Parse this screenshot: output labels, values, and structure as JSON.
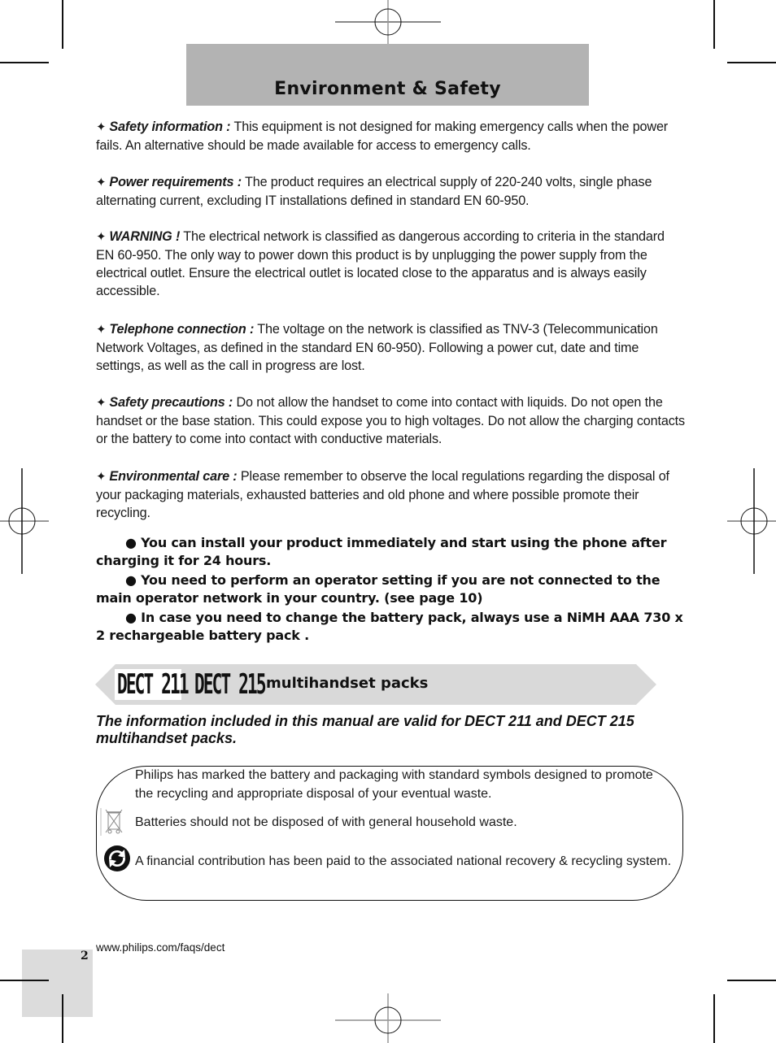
{
  "header": {
    "title": "Environment & Safety"
  },
  "sections": [
    {
      "lead": "Safety information :",
      "text": " This equipment is not designed for making emergency calls when the power fails. An alternative should be made available for access to emergency calls."
    },
    {
      "lead": "Power requirements :",
      "text": " The product requires an electrical supply of 220-240 volts, single phase alternating current, excluding IT installations defined in standard EN 60-950."
    },
    {
      "lead": "WARNING !",
      "text": " The electrical network is classified as dangerous according to criteria in the standard EN 60-950. The only way to power down this product is by unplugging the power supply from the electrical outlet. Ensure the electrical outlet is located close to the apparatus and is always easily accessible."
    },
    {
      "lead": "Telephone connection :",
      "text": " The voltage on the network is classified as TNV-3 (Telecommunication Network Voltages, as defined in the standard EN 60-950). Following a power cut, date and time settings, as well as the call in progress are lost."
    },
    {
      "lead": "Safety precautions :",
      "text": " Do not allow the handset to come into contact with liquids. Do not open the handset or the base station. This could expose you to high voltages. Do not allow the charging contacts or the battery to come into contact with conductive materials."
    },
    {
      "lead": "Environmental care :",
      "text": " Please remember to observe the local regulations regarding the disposal of your packaging materials, exhausted batteries and old phone and where possible promote their recycling."
    }
  ],
  "bullet_char": "✦",
  "notes": [
    "● You can install your product immediately and start using the phone after charging it for 24 hours.",
    "● You need to perform an operator setting if you are not connected to the main operator network in your country. (see page 10)",
    "● In case you need to change the battery pack, always use a NiMH AAA 730 x 2 rechargeable battery pack ."
  ],
  "banner": {
    "logo1": "DECT 211",
    "logo2": "DECT 215",
    "label": "multihandset packs"
  },
  "validity_note": "The information included in this manual are valid for DECT 211 and DECT 215 multihandset packs.",
  "info_box": {
    "intro": "Philips has marked the battery and packaging with standard symbols designed to promote the recycling and appropriate disposal of your eventual waste.",
    "bin_text": "Batteries should not be disposed of with general household waste.",
    "recycle_text": "A financial contribution has been paid to the associated national recovery & recycling system.",
    "icons": [
      "crossed-bin-icon",
      "green-dot-recycle-icon"
    ]
  },
  "footer": {
    "page_number": "2",
    "url": "www.philips.com/faqs/dect"
  },
  "colors": {
    "title_band": "#b3b3b3",
    "banner": "#d9d9d9",
    "page_tab": "#dcdcdc"
  }
}
